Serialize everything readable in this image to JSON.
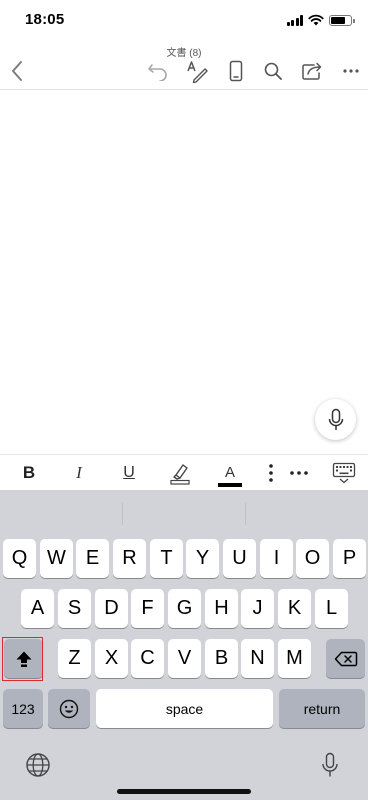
{
  "status_bar": {
    "time": "18:05",
    "battery_level_fraction": 0.75
  },
  "document": {
    "title": "文書 (8)"
  },
  "toolbar": {
    "icons": [
      "back-chevron-icon",
      "undo-icon",
      "pen-edit-icon",
      "phone-layout-icon",
      "search-icon",
      "share-icon",
      "more-icon"
    ]
  },
  "format_bar": {
    "bold": "B",
    "italic": "I",
    "underline": "U",
    "font_color_letter": "A",
    "font_color": "#000000"
  },
  "keyboard": {
    "row1": [
      "Q",
      "W",
      "E",
      "R",
      "T",
      "Y",
      "U",
      "I",
      "O",
      "P"
    ],
    "row2": [
      "A",
      "S",
      "D",
      "F",
      "G",
      "H",
      "J",
      "K",
      "L"
    ],
    "row3": [
      "Z",
      "X",
      "C",
      "V",
      "B",
      "N",
      "M"
    ],
    "numbers_label": "123",
    "space_label": "space",
    "return_label": "return"
  },
  "colors": {
    "keyboard_bg": "#d1d3d9",
    "key_bg": "#ffffff",
    "dark_key_bg": "#aeb3bd",
    "highlight": "#e0282e"
  }
}
